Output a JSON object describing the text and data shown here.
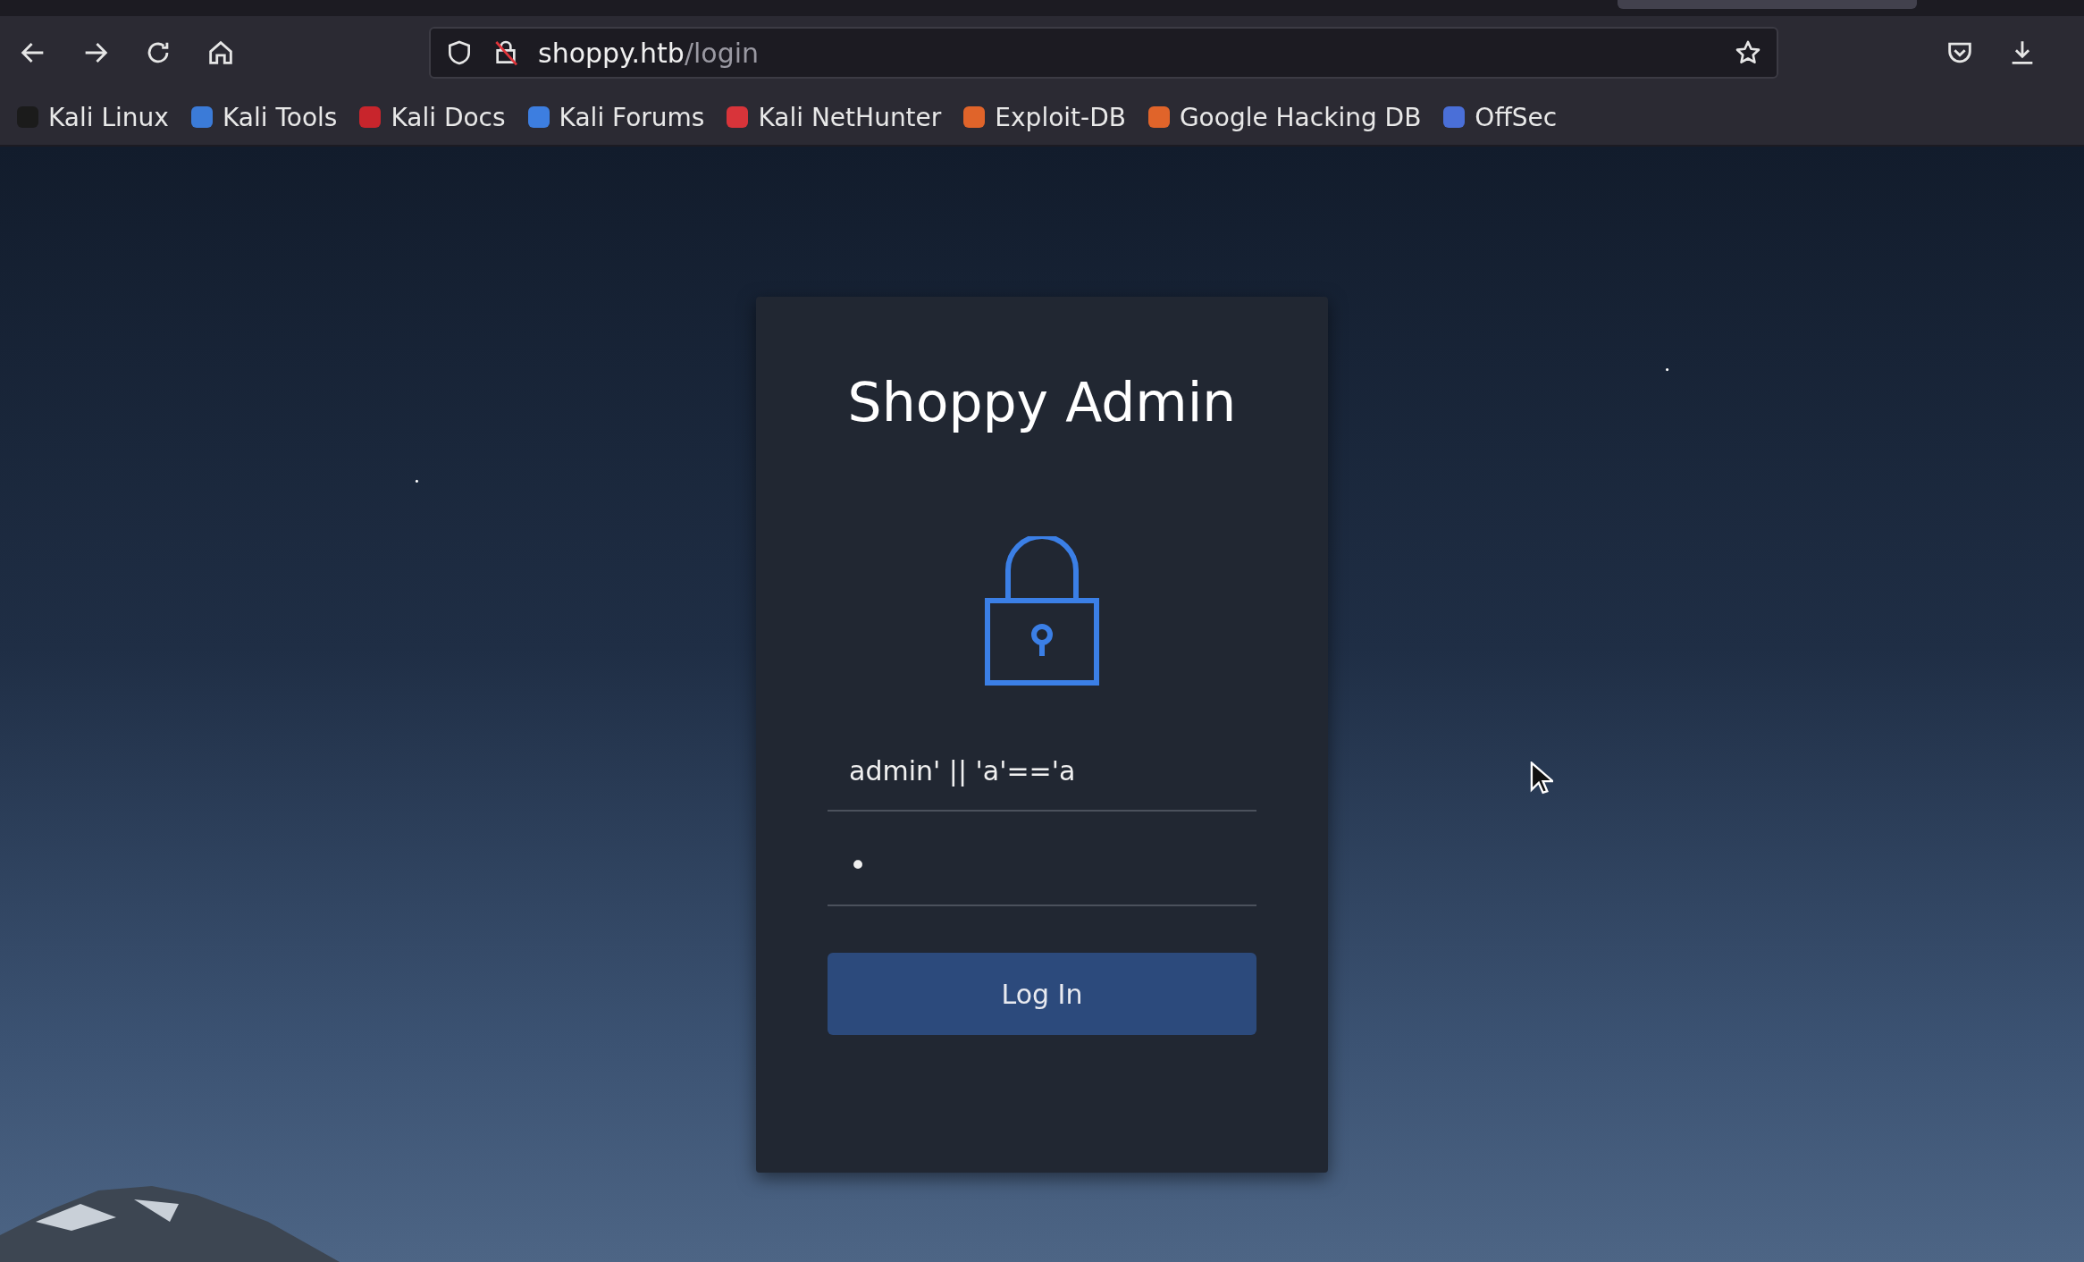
{
  "browser": {
    "url": {
      "host": "shoppy.htb",
      "path": "/login"
    },
    "bookmarks": [
      {
        "label": "Kali Linux",
        "color": "#1b1b1b"
      },
      {
        "label": "Kali Tools",
        "color": "#3b7bd8"
      },
      {
        "label": "Kali Docs",
        "color": "#c8252c"
      },
      {
        "label": "Kali Forums",
        "color": "#3d7ee0"
      },
      {
        "label": "Kali NetHunter",
        "color": "#d8343a"
      },
      {
        "label": "Exploit-DB",
        "color": "#e0642a"
      },
      {
        "label": "Google Hacking DB",
        "color": "#e0642a"
      },
      {
        "label": "OffSec",
        "color": "#4a6fd8"
      }
    ]
  },
  "login": {
    "title": "Shoppy Admin",
    "username": {
      "value": "admin' || 'a'=='a"
    },
    "password": {
      "value": "•"
    },
    "button": "Log In"
  }
}
